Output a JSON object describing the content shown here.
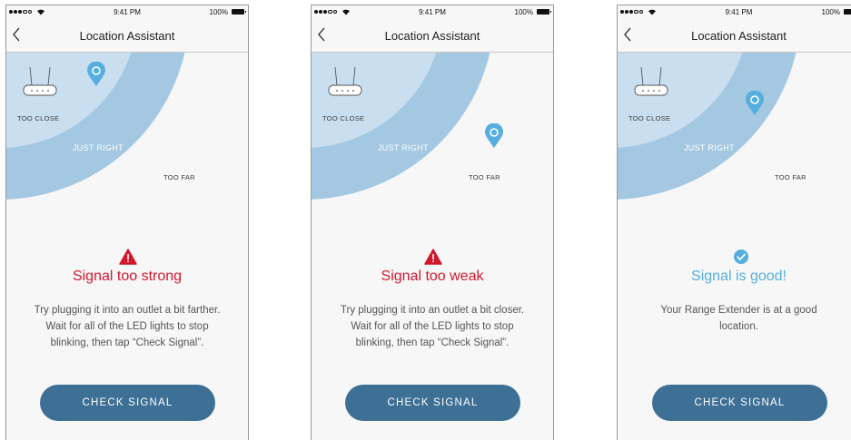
{
  "colors": {
    "zone_far": "#a4c8e2",
    "zone_close": "#c9dff0",
    "pin": "#55aede",
    "warning_red": "#d0182f",
    "success_blue": "#55aede",
    "button": "#3e6f95"
  },
  "screens": [
    {
      "status_bar": {
        "time": "9:41 PM",
        "battery": "100%"
      },
      "nav": {
        "title": "Location Assistant"
      },
      "zones": {
        "too_close": "TOO CLOSE",
        "just_right": "JUST RIGHT",
        "too_far": "TOO FAR"
      },
      "status": {
        "type": "warning",
        "icon": "warning-icon",
        "title": "Signal too strong",
        "message": "Try plugging it into an outlet a bit farther. Wait for all of the LED lights to stop blinking, then tap “Check Signal”."
      },
      "button": "CHECK SIGNAL"
    },
    {
      "status_bar": {
        "time": "9:41 PM",
        "battery": "100%"
      },
      "nav": {
        "title": "Location Assistant"
      },
      "zones": {
        "too_close": "TOO CLOSE",
        "just_right": "JUST RIGHT",
        "too_far": "TOO FAR"
      },
      "status": {
        "type": "warning",
        "icon": "warning-icon",
        "title": "Signal too weak",
        "message": "Try plugging it into an outlet a bit closer. Wait for all of the LED lights to stop blinking, then tap “Check Signal”."
      },
      "button": "CHECK SIGNAL"
    },
    {
      "status_bar": {
        "time": "9:41 PM",
        "battery": "100%"
      },
      "nav": {
        "title": "Location Assistant"
      },
      "zones": {
        "too_close": "TOO CLOSE",
        "just_right": "JUST RIGHT",
        "too_far": "TOO FAR"
      },
      "status": {
        "type": "success",
        "icon": "check-circle-icon",
        "title": "Signal is good!",
        "message": "Your Range Extender is at a good location."
      },
      "button": "CHECK SIGNAL"
    }
  ]
}
